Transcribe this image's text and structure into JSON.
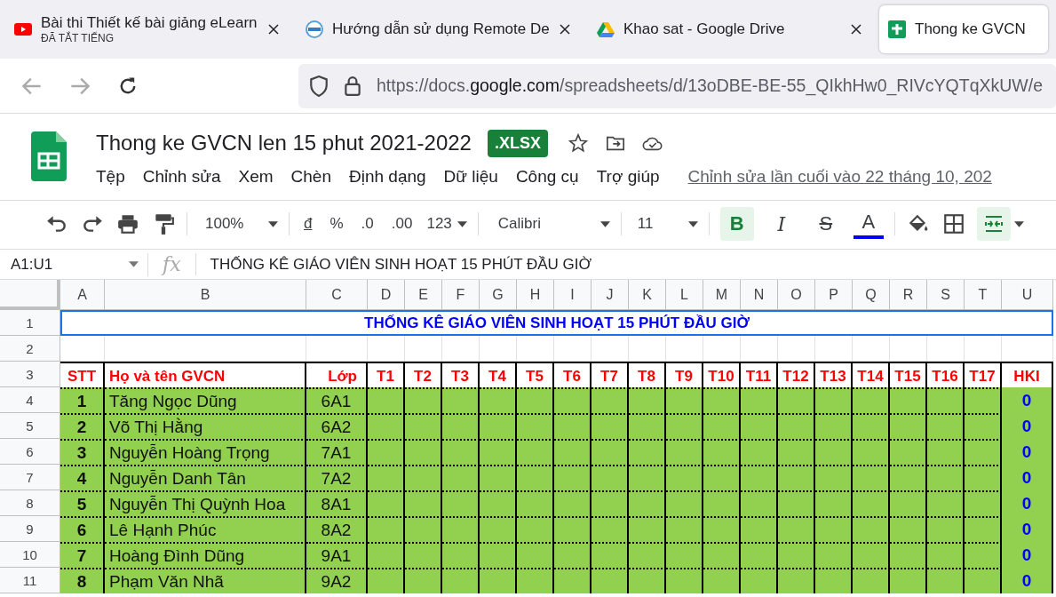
{
  "browser": {
    "tabs": [
      {
        "title": "Bài thi Thiết kế bài giảng eLearn",
        "subtitle": "ĐÃ TẮT TIẾNG",
        "kind": "video",
        "selected": false,
        "closable": true
      },
      {
        "title": "Hướng dẫn sử dụng Remote De",
        "kind": "site",
        "selected": false,
        "closable": true
      },
      {
        "title": "Khao sat - Google Drive",
        "kind": "drive",
        "selected": false,
        "closable": true
      },
      {
        "title": "Thong ke GVCN",
        "kind": "sheets",
        "selected": true,
        "closable": false
      }
    ],
    "address": {
      "prefix": "https://docs.",
      "domain": "google.com",
      "path": "/spreadsheets/d/13oDBE-BE-55_QIkhHw0_RIVcYQTqXkUW/e"
    }
  },
  "document": {
    "title": "Thong ke GVCN len 15 phut 2021-2022",
    "badge": ".XLSX",
    "menu": [
      "Tệp",
      "Chỉnh sửa",
      "Xem",
      "Chèn",
      "Định dạng",
      "Dữ liệu",
      "Công cụ",
      "Trợ giúp"
    ],
    "last_edit": "Chỉnh sửa lần cuối vào 22 tháng 10, 202"
  },
  "toolbar": {
    "zoom": "100%",
    "currency": "đ",
    "percent": "%",
    "decrease_decimal": ".0",
    "increase_decimal": ".00",
    "number_format": "123",
    "font": "Calibri",
    "font_size": "11",
    "styles": [
      {
        "label": "B",
        "kind": "bold",
        "on": true
      },
      {
        "label": "I",
        "kind": "italic",
        "on": false
      },
      {
        "label": "S",
        "kind": "strike",
        "on": false
      },
      {
        "label": "A",
        "kind": "color",
        "on": false
      }
    ],
    "merge_on": true
  },
  "formula_bar": {
    "name_box": "A1:U1",
    "fx": "fx",
    "value": "THỐNG KÊ GIÁO VIÊN SINH HOẠT 15 PHÚT ĐẦU GIỜ"
  },
  "sheet": {
    "column_letters": [
      "A",
      "B",
      "C",
      "D",
      "E",
      "F",
      "G",
      "H",
      "I",
      "J",
      "K",
      "L",
      "M",
      "N",
      "O",
      "P",
      "Q",
      "R",
      "S",
      "T",
      "U"
    ],
    "row_numbers": [
      "1",
      "2",
      "3",
      "4",
      "5",
      "6",
      "7",
      "8",
      "9",
      "10",
      "11"
    ],
    "title_cell": {
      "text": "THỐNG KÊ GIÁO VIÊN SINH HOẠT 15 PHÚT ĐẦU GIỜ",
      "selected": true
    },
    "header_row": [
      "STT",
      "Họ và tên GVCN",
      "Lớp",
      "T1",
      "T2",
      "T3",
      "T4",
      "T5",
      "T6",
      "T7",
      "T8",
      "T9",
      "T10",
      "T11",
      "T12",
      "T13",
      "T14",
      "T15",
      "T16",
      "T17",
      "HKI"
    ],
    "rows": [
      {
        "stt": "1",
        "name": "Tăng Ngọc Dũng",
        "class": "6A1",
        "hki": "0"
      },
      {
        "stt": "2",
        "name": "Võ Thị Hằng",
        "class": "6A2",
        "hki": "0"
      },
      {
        "stt": "3",
        "name": "Nguyễn Hoàng Trọng",
        "class": "7A1",
        "hki": "0"
      },
      {
        "stt": "4",
        "name": "Nguyễn Danh Tân",
        "class": "7A2",
        "hki": "0"
      },
      {
        "stt": "5",
        "name": "Nguyễn Thị Quỳnh Hoa",
        "class": "8A1",
        "hki": "0"
      },
      {
        "stt": "6",
        "name": "Lê Hạnh Phúc",
        "class": "8A2",
        "hki": "0"
      },
      {
        "stt": "7",
        "name": "Hoàng Đình Dũng",
        "class": "9A1",
        "hki": "0"
      },
      {
        "stt": "8",
        "name": "Phạm Văn Nhã",
        "class": "9A2",
        "hki": "0"
      }
    ]
  }
}
